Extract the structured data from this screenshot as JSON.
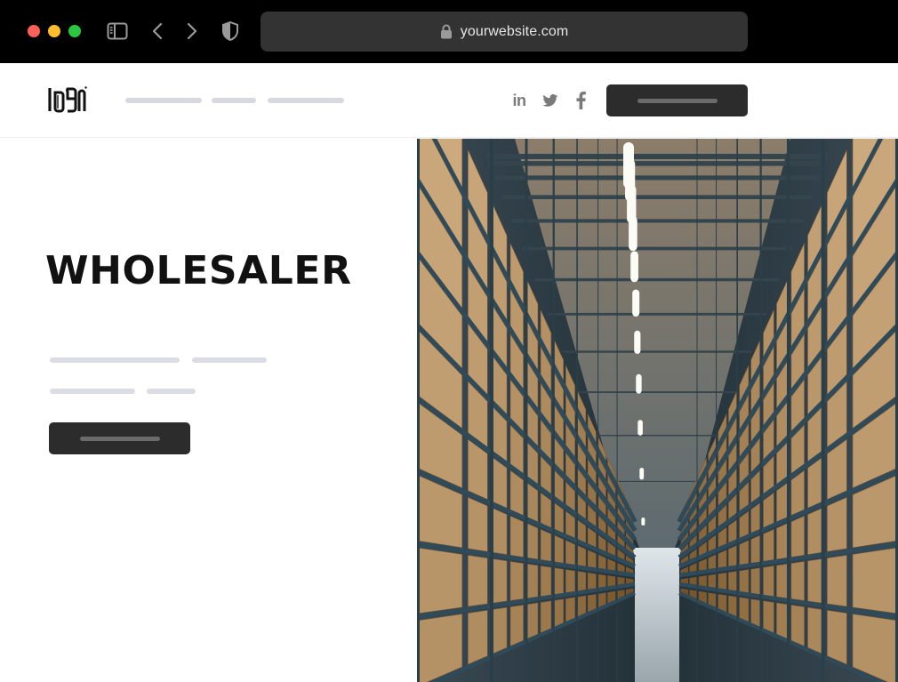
{
  "browser": {
    "url": "yourwebsite.com",
    "icons": [
      "sidebar-icon",
      "back-arrow-icon",
      "forward-arrow-icon",
      "shield-icon",
      "lock-icon"
    ]
  },
  "header": {
    "logo_text": "LOGO",
    "social_icons": [
      "linkedin-icon",
      "twitter-icon",
      "facebook-icon"
    ],
    "linkedin_glyph": "in"
  },
  "hero": {
    "title": "WHOLESALER"
  },
  "colors": {
    "chrome_bg": "#000000",
    "address_bar": "#333333",
    "button_dark": "#2c2c2c",
    "placeholder_line": "#d8d8e0",
    "title_text": "#111111"
  }
}
